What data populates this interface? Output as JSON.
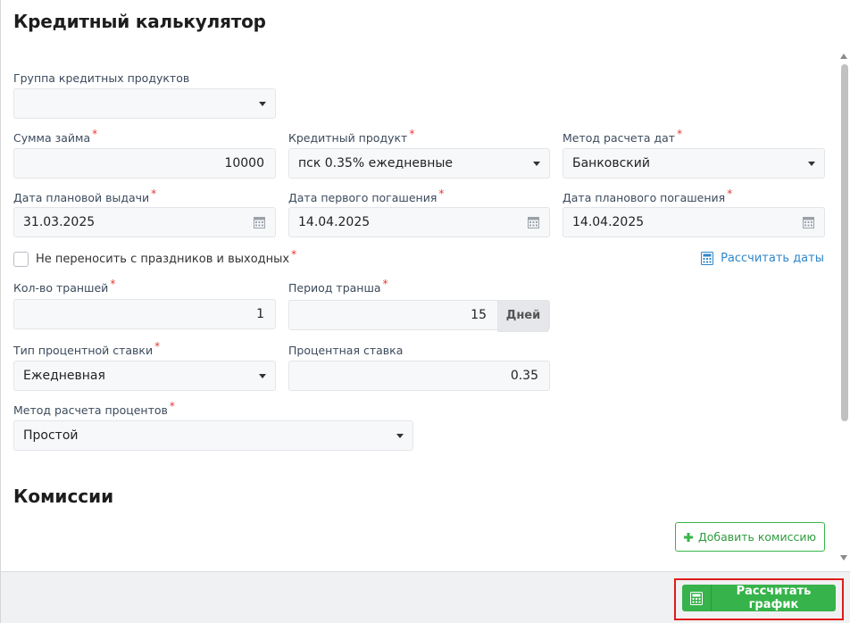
{
  "title": "Кредитный калькулятор",
  "fields": {
    "product_group": {
      "label": "Группа кредитных продуктов",
      "value": ""
    },
    "loan_amount": {
      "label": "Сумма займа",
      "value": "10000"
    },
    "credit_product": {
      "label": "Кредитный продукт",
      "value": "пск 0.35% ежедневные"
    },
    "date_method": {
      "label": "Метод расчета дат",
      "value": "Банковский"
    },
    "issue_date": {
      "label": "Дата плановой выдачи",
      "value": "31.03.2025"
    },
    "first_payment_date": {
      "label": "Дата первого погашения",
      "value": "14.04.2025"
    },
    "repayment_date": {
      "label": "Дата планового погашения",
      "value": "14.04.2025"
    },
    "tranche_count": {
      "label": "Кол-во траншей",
      "value": "1"
    },
    "tranche_period": {
      "label": "Период транша",
      "value": "15",
      "unit": "Дней"
    },
    "rate_type": {
      "label": "Тип процентной ставки",
      "value": "Ежедневная"
    },
    "rate": {
      "label": "Процентная ставка",
      "value": "0.35"
    },
    "interest_method": {
      "label": "Метод расчета процентов",
      "value": "Простой"
    }
  },
  "required_mark": "*",
  "no_holiday_shift": {
    "label": "Не переносить с праздников и выходных",
    "checked": false
  },
  "calc_dates_link": "Рассчитать даты",
  "commissions": {
    "title": "Комиссии",
    "add_button": "Добавить комиссию"
  },
  "footer": {
    "calc_schedule_button": "Рассчитать график"
  },
  "colors": {
    "accent_green": "#36b34a",
    "link_blue": "#2f86c9",
    "required_red": "#e53935",
    "highlight_red": "#e01b1b"
  },
  "icons": {
    "calendar": "calendar-icon",
    "calculator": "calculator-icon",
    "plus": "plus-icon",
    "caret": "chevron-down-icon"
  }
}
